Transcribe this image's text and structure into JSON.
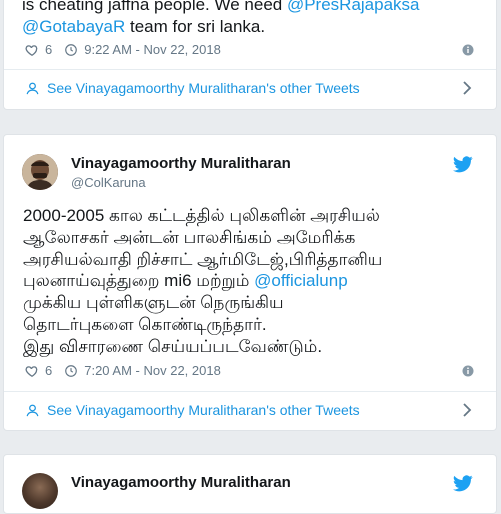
{
  "tweet1": {
    "text_line1_prefix": "is cheating jaffna people. We need ",
    "mention1": "@PresRajapaksa",
    "mention2": "@GotabayaR",
    "text_line2_suffix": " team for sri lanka.",
    "likes": "6",
    "timestamp": "9:22 AM - Nov 22, 2018",
    "other_tweets_link": "See Vinayagamoorthy Muralitharan's other Tweets"
  },
  "tweet2": {
    "author_name": "Vinayagamoorthy Muralitharan",
    "author_handle": "@ColKaruna",
    "lines": [
      "2000-2005 கால கட்டத்தில் புலிகளின் அரசியல்",
      "ஆலோசகர் அன்டன் பாலசிங்கம் அமேரிக்க",
      "அரசியல்வாதி றிச்சாட் ஆர்மிடேஜ்,பிரித்தானிய"
    ],
    "line4_prefix": "புலனாய்வுத்துறை mi6 மற்றும் ",
    "line4_mention": "@officialunp",
    "lines_after": [
      "முக்கிய புள்ளிகளுடன்  நெருங்கிய",
      "தொடர்புகளை கொண்டிருந்தார்.",
      "இது விசாரணை செய்யப்படவேண்டும்."
    ],
    "likes": "6",
    "timestamp": "7:20 AM - Nov 22, 2018",
    "other_tweets_link": "See Vinayagamoorthy Muralitharan's other Tweets"
  },
  "tweet3": {
    "author_name": "Vinayagamoorthy Muralitharan"
  },
  "icons": {
    "like": "heart-icon",
    "time": "clock-icon",
    "info": "info-icon",
    "profile": "user-icon",
    "chevron": "chevron-right-icon",
    "brand": "twitter-bird-icon"
  },
  "colors": {
    "accent": "#1b95e0",
    "muted": "#657786",
    "twitter_blue": "#1da1f2",
    "background": "#e9ecef"
  }
}
